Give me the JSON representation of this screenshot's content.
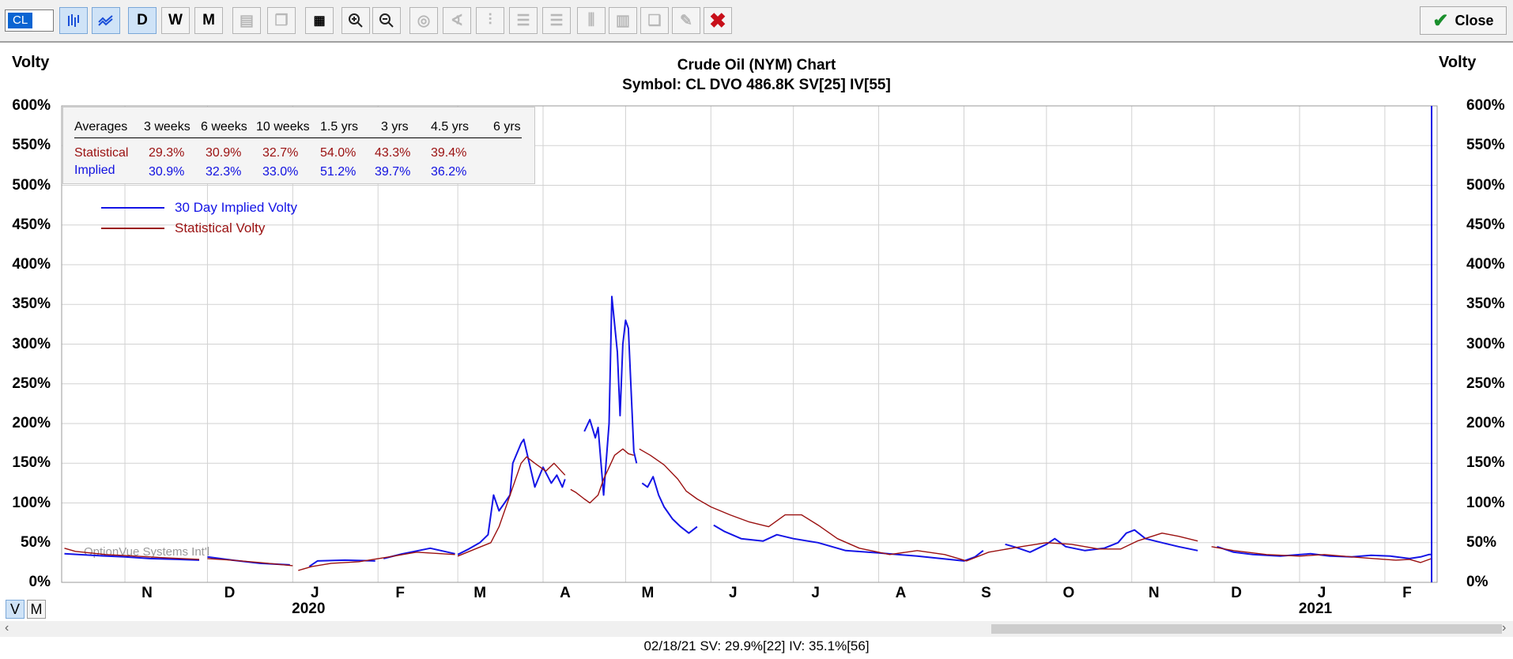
{
  "toolbar": {
    "symbol": "CL",
    "period_buttons": [
      "D",
      "W",
      "M"
    ],
    "close_label": "Close"
  },
  "axis_title": "Volty",
  "chart_title": "Crude Oil (NYM) Chart",
  "chart_subtitle": "Symbol: CL  DVO 486.8K  SV[25]  IV[55]",
  "watermark": "OptionVue Systems Int'l",
  "averages_table": {
    "headers": [
      "Averages",
      "3 weeks",
      "6 weeks",
      "10 weeks",
      "1.5 yrs",
      "3 yrs",
      "4.5 yrs",
      "6 yrs"
    ],
    "statistical": {
      "label": "Statistical",
      "values": [
        "29.3%",
        "30.9%",
        "32.7%",
        "54.0%",
        "43.3%",
        "39.4%",
        ""
      ]
    },
    "implied": {
      "label": "Implied",
      "values": [
        "30.9%",
        "32.3%",
        "33.0%",
        "51.2%",
        "39.7%",
        "36.2%",
        ""
      ]
    }
  },
  "view_toggle": {
    "v": "V",
    "m": "M"
  },
  "status_line": "02/18/21  SV: 29.9%[22]  IV: 35.1%[56]",
  "chart_data": {
    "type": "line",
    "title": "Crude Oil (NYM) Chart",
    "subtitle": "Symbol: CL  DVO 486.8K  SV[25]  IV[55]",
    "ylabel": "Volty",
    "ylim": [
      0,
      600
    ],
    "yticks": [
      "0%",
      "50%",
      "100%",
      "150%",
      "200%",
      "250%",
      "300%",
      "350%",
      "400%",
      "450%",
      "500%",
      "550%",
      "600%"
    ],
    "x_range": [
      "2019-10-09",
      "2021-02-20"
    ],
    "xticks": [
      {
        "label": "N",
        "date": "2019-11-01"
      },
      {
        "label": "D",
        "date": "2019-12-01"
      },
      {
        "label": "J",
        "date": "2020-01-01"
      },
      {
        "label": "F",
        "date": "2020-02-01"
      },
      {
        "label": "M",
        "date": "2020-03-01"
      },
      {
        "label": "A",
        "date": "2020-04-01"
      },
      {
        "label": "M",
        "date": "2020-05-01"
      },
      {
        "label": "J",
        "date": "2020-06-01"
      },
      {
        "label": "J",
        "date": "2020-07-01"
      },
      {
        "label": "A",
        "date": "2020-08-01"
      },
      {
        "label": "S",
        "date": "2020-09-01"
      },
      {
        "label": "O",
        "date": "2020-10-01"
      },
      {
        "label": "N",
        "date": "2020-11-01"
      },
      {
        "label": "D",
        "date": "2020-12-01"
      },
      {
        "label": "J",
        "date": "2021-01-01"
      },
      {
        "label": "F",
        "date": "2021-02-01"
      }
    ],
    "year_labels": [
      {
        "label": "2020",
        "date": "2020-01-01"
      },
      {
        "label": "2021",
        "date": "2021-01-01"
      }
    ],
    "cursor_date": "2021-02-18",
    "grid": true,
    "legend_position": "top-left",
    "series": [
      {
        "name": "30 Day Implied Volty",
        "color": "#1414e6",
        "segments": [
          [
            [
              "2019-10-10",
              36
            ],
            [
              "2019-10-20",
              34
            ],
            [
              "2019-11-01",
              32
            ],
            [
              "2019-11-10",
              30
            ],
            [
              "2019-11-20",
              29
            ],
            [
              "2019-11-28",
              28
            ]
          ],
          [
            [
              "2019-12-01",
              32
            ],
            [
              "2019-12-10",
              28
            ],
            [
              "2019-12-20",
              24
            ],
            [
              "2019-12-31",
              22
            ]
          ],
          [
            [
              "2020-01-07",
              20
            ],
            [
              "2020-01-10",
              27
            ],
            [
              "2020-01-20",
              28
            ],
            [
              "2020-01-31",
              27
            ]
          ],
          [
            [
              "2020-02-03",
              30
            ],
            [
              "2020-02-10",
              36
            ],
            [
              "2020-02-20",
              43
            ],
            [
              "2020-02-29",
              36
            ]
          ],
          [
            [
              "2020-03-01",
              35
            ],
            [
              "2020-03-05",
              42
            ],
            [
              "2020-03-09",
              50
            ],
            [
              "2020-03-12",
              60
            ],
            [
              "2020-03-14",
              110
            ],
            [
              "2020-03-16",
              90
            ],
            [
              "2020-03-18",
              100
            ],
            [
              "2020-03-20",
              110
            ],
            [
              "2020-03-21",
              150
            ],
            [
              "2020-03-24",
              175
            ],
            [
              "2020-03-25",
              180
            ],
            [
              "2020-03-27",
              150
            ],
            [
              "2020-03-29",
              120
            ],
            [
              "2020-04-01",
              145
            ],
            [
              "2020-04-04",
              125
            ],
            [
              "2020-04-06",
              135
            ],
            [
              "2020-04-08",
              120
            ],
            [
              "2020-04-09",
              130
            ]
          ],
          [
            [
              "2020-04-16",
              190
            ],
            [
              "2020-04-18",
              205
            ],
            [
              "2020-04-20",
              182
            ],
            [
              "2020-04-21",
              195
            ],
            [
              "2020-04-23",
              110
            ],
            [
              "2020-04-25",
              200
            ],
            [
              "2020-04-26",
              360
            ],
            [
              "2020-04-28",
              290
            ],
            [
              "2020-04-29",
              210
            ],
            [
              "2020-04-30",
              300
            ],
            [
              "2020-05-01",
              330
            ],
            [
              "2020-05-02",
              320
            ],
            [
              "2020-05-04",
              165
            ],
            [
              "2020-05-05",
              150
            ]
          ],
          [
            [
              "2020-05-07",
              125
            ],
            [
              "2020-05-09",
              120
            ],
            [
              "2020-05-11",
              133
            ],
            [
              "2020-05-13",
              110
            ],
            [
              "2020-05-15",
              95
            ],
            [
              "2020-05-18",
              80
            ],
            [
              "2020-05-21",
              70
            ],
            [
              "2020-05-24",
              62
            ],
            [
              "2020-05-27",
              70
            ]
          ],
          [
            [
              "2020-06-02",
              72
            ],
            [
              "2020-06-06",
              64
            ],
            [
              "2020-06-12",
              55
            ],
            [
              "2020-06-20",
              52
            ],
            [
              "2020-06-25",
              60
            ],
            [
              "2020-07-01",
              55
            ],
            [
              "2020-07-10",
              50
            ],
            [
              "2020-07-20",
              40
            ],
            [
              "2020-08-01",
              37
            ],
            [
              "2020-08-15",
              33
            ],
            [
              "2020-09-01",
              27
            ],
            [
              "2020-09-05",
              32
            ],
            [
              "2020-09-08",
              40
            ]
          ],
          [
            [
              "2020-09-16",
              48
            ],
            [
              "2020-09-20",
              44
            ],
            [
              "2020-09-25",
              38
            ],
            [
              "2020-10-01",
              48
            ],
            [
              "2020-10-04",
              55
            ],
            [
              "2020-10-08",
              45
            ],
            [
              "2020-10-15",
              40
            ],
            [
              "2020-10-22",
              43
            ],
            [
              "2020-10-27",
              50
            ],
            [
              "2020-10-30",
              62
            ],
            [
              "2020-11-02",
              66
            ],
            [
              "2020-11-06",
              55
            ],
            [
              "2020-11-12",
              50
            ],
            [
              "2020-11-18",
              45
            ],
            [
              "2020-11-25",
              40
            ]
          ],
          [
            [
              "2020-12-02",
              45
            ],
            [
              "2020-12-08",
              38
            ],
            [
              "2020-12-15",
              35
            ],
            [
              "2020-12-25",
              33
            ],
            [
              "2021-01-05",
              36
            ],
            [
              "2021-01-12",
              33
            ],
            [
              "2021-01-20",
              32
            ],
            [
              "2021-01-27",
              34
            ],
            [
              "2021-02-03",
              33
            ],
            [
              "2021-02-10",
              30
            ],
            [
              "2021-02-14",
              32
            ],
            [
              "2021-02-17",
              35
            ],
            [
              "2021-02-18",
              35
            ]
          ]
        ]
      },
      {
        "name": "Statistical Volty",
        "color": "#9a1010",
        "segments": [
          [
            [
              "2019-10-10",
              43
            ],
            [
              "2019-10-14",
              39
            ],
            [
              "2019-10-25",
              35
            ],
            [
              "2019-11-05",
              33
            ],
            [
              "2019-11-15",
              31
            ],
            [
              "2019-11-28",
              29
            ]
          ],
          [
            [
              "2019-12-01",
              30
            ],
            [
              "2019-12-10",
              28
            ],
            [
              "2019-12-20",
              25
            ],
            [
              "2020-01-01",
              21
            ]
          ],
          [
            [
              "2020-01-03",
              15
            ],
            [
              "2020-01-08",
              20
            ],
            [
              "2020-01-15",
              24
            ],
            [
              "2020-01-25",
              26
            ],
            [
              "2020-02-05",
              32
            ],
            [
              "2020-02-15",
              38
            ],
            [
              "2020-02-29",
              35
            ]
          ],
          [
            [
              "2020-03-01",
              33
            ],
            [
              "2020-03-08",
              43
            ],
            [
              "2020-03-13",
              50
            ],
            [
              "2020-03-16",
              70
            ],
            [
              "2020-03-19",
              100
            ],
            [
              "2020-03-24",
              150
            ],
            [
              "2020-03-26",
              158
            ],
            [
              "2020-03-29",
              150
            ],
            [
              "2020-04-02",
              140
            ],
            [
              "2020-04-05",
              150
            ],
            [
              "2020-04-09",
              135
            ]
          ],
          [
            [
              "2020-04-11",
              117
            ],
            [
              "2020-04-13",
              113
            ],
            [
              "2020-04-16",
              105
            ],
            [
              "2020-04-18",
              100
            ],
            [
              "2020-04-21",
              110
            ],
            [
              "2020-04-23",
              130
            ],
            [
              "2020-04-27",
              160
            ],
            [
              "2020-04-30",
              168
            ],
            [
              "2020-05-02",
              162
            ],
            [
              "2020-05-04",
              160
            ]
          ],
          [
            [
              "2020-05-06",
              168
            ],
            [
              "2020-05-10",
              160
            ],
            [
              "2020-05-15",
              148
            ],
            [
              "2020-05-20",
              130
            ],
            [
              "2020-05-23",
              115
            ],
            [
              "2020-05-27",
              105
            ],
            [
              "2020-06-01",
              95
            ],
            [
              "2020-06-08",
              85
            ],
            [
              "2020-06-15",
              76
            ],
            [
              "2020-06-22",
              70
            ],
            [
              "2020-06-28",
              85
            ],
            [
              "2020-07-04",
              85
            ],
            [
              "2020-07-10",
              72
            ],
            [
              "2020-07-17",
              55
            ],
            [
              "2020-07-25",
              43
            ],
            [
              "2020-08-05",
              35
            ],
            [
              "2020-08-15",
              40
            ],
            [
              "2020-08-25",
              35
            ],
            [
              "2020-09-02",
              27
            ],
            [
              "2020-09-10",
              38
            ],
            [
              "2020-09-20",
              44
            ],
            [
              "2020-10-01",
              50
            ],
            [
              "2020-10-10",
              48
            ],
            [
              "2020-10-20",
              42
            ],
            [
              "2020-10-28",
              42
            ],
            [
              "2020-11-03",
              52
            ],
            [
              "2020-11-12",
              62
            ],
            [
              "2020-11-18",
              58
            ],
            [
              "2020-11-25",
              52
            ]
          ],
          [
            [
              "2020-11-30",
              45
            ],
            [
              "2020-12-08",
              40
            ],
            [
              "2020-12-20",
              35
            ],
            [
              "2021-01-01",
              33
            ],
            [
              "2021-01-10",
              35
            ],
            [
              "2021-01-20",
              32
            ],
            [
              "2021-01-28",
              30
            ],
            [
              "2021-02-05",
              28
            ],
            [
              "2021-02-10",
              29
            ],
            [
              "2021-02-14",
              25
            ],
            [
              "2021-02-18",
              30
            ]
          ]
        ]
      }
    ]
  }
}
